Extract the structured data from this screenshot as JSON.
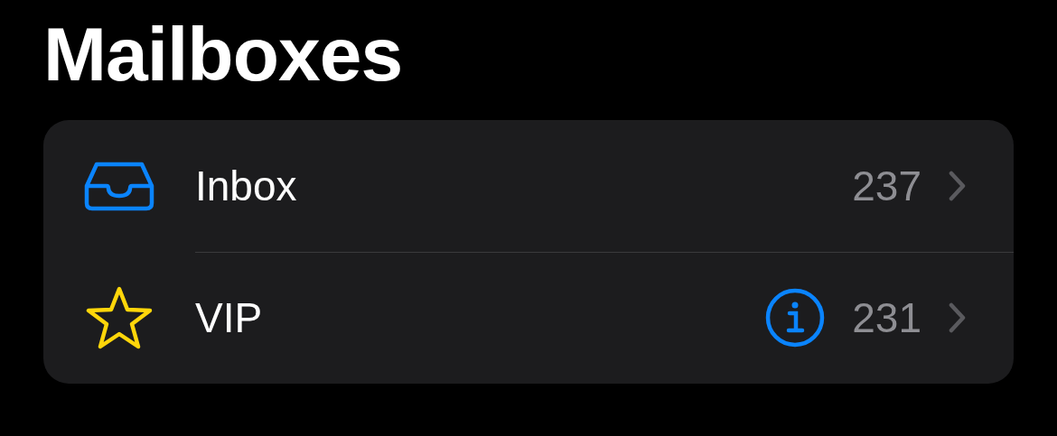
{
  "title": "Mailboxes",
  "mailboxes": [
    {
      "kind": "inbox",
      "label": "Inbox",
      "info_button": false,
      "count": "237"
    },
    {
      "kind": "vip",
      "label": "VIP",
      "info_button": true,
      "count": "231"
    }
  ]
}
